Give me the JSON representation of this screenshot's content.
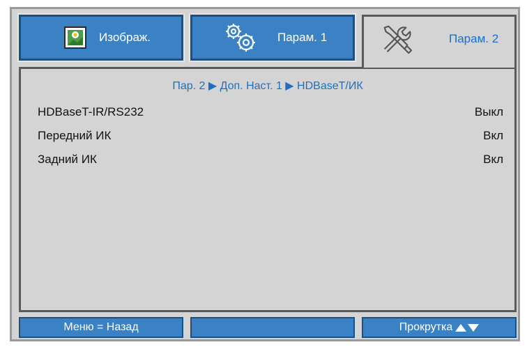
{
  "tabs": [
    {
      "label": "Изображ.",
      "icon": "image-icon",
      "active": false
    },
    {
      "label": "Парам. 1",
      "icon": "gears-icon",
      "active": false
    },
    {
      "label": "Парам. 2",
      "icon": "tools-icon",
      "active": true
    }
  ],
  "breadcrumb": "Пар. 2 ▶ Доп. Наст. 1 ▶ HDBaseT/ИК",
  "settings": [
    {
      "name": "HDBaseT-IR/RS232",
      "value": "Выкл"
    },
    {
      "name": "Передний ИК",
      "value": "Вкл"
    },
    {
      "name": "Задний ИК",
      "value": "Вкл"
    }
  ],
  "footer": {
    "back_label": "Меню = Назад",
    "middle_label": "",
    "scroll_label": "Прокрутка"
  },
  "colors": {
    "accent": "#1f6fc0",
    "tab_blue": "#3a82c4",
    "panel_gray": "#d4d4d4"
  }
}
